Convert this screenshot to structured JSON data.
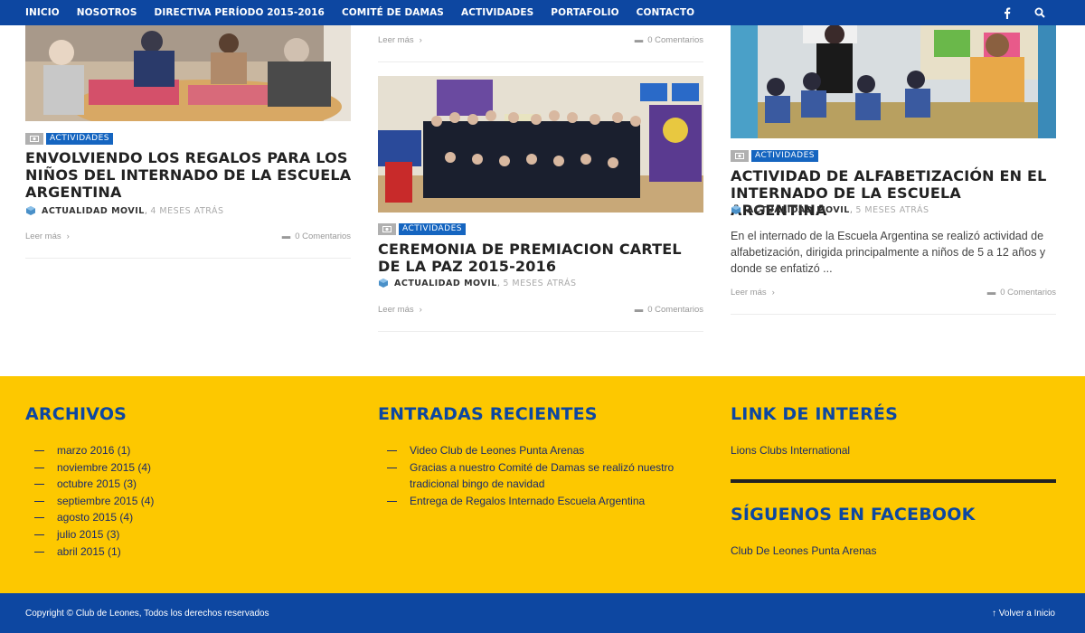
{
  "nav": {
    "items": [
      "INICIO",
      "NOSOTROS",
      "DIRECTIVA PERÍODO 2015-2016",
      "COMITÉ DE DAMAS",
      "ACTIVIDADES",
      "PORTAFOLIO",
      "CONTACTO"
    ],
    "icons": [
      "facebook-icon",
      "search-icon"
    ]
  },
  "posts": [
    {
      "category": "ACTIVIDADES",
      "title": "ENVOLVIENDO LOS REGALOS PARA LOS NIÑOS DEL INTERNADO DE LA ESCUELA ARGENTINA",
      "author": "ACTUALIDAD MOVIL",
      "ago": "4 MESES ATRÁS",
      "read_more": "Leer más",
      "comments": "0 Comentarios"
    },
    {
      "category": "ACTIVIDADES",
      "title": "CEREMONIA DE PREMIACION CARTEL DE LA PAZ 2015-2016",
      "author": "ACTUALIDAD MOVIL",
      "ago": "5 MESES ATRÁS",
      "read_more": "Leer más",
      "comments": "0 Comentarios",
      "prev_read_more": "Leer más",
      "prev_comments": "0 Comentarios"
    },
    {
      "category": "ACTIVIDADES",
      "title": "ACTIVIDAD DE ALFABETIZACIÓN EN EL INTERNADO DE LA ESCUELA ARGENTINA",
      "author": "ACTUALIDAD MOVIL",
      "ago": "5 MESES ATRÁS",
      "excerpt": "En el internado de la Escuela Argentina se realizó actividad de alfabetización, dirigida principalmente a niños de 5 a 12 años y donde se enfatizó ...",
      "read_more": "Leer más",
      "comments": "0 Comentarios"
    }
  ],
  "footer": {
    "archivos": {
      "title": "ARCHIVOS",
      "items": [
        "marzo 2016 (1)",
        "noviembre 2015 (4)",
        "octubre 2015 (3)",
        "septiembre 2015 (4)",
        "agosto 2015 (4)",
        "julio 2015 (3)",
        "abril 2015 (1)"
      ]
    },
    "entradas": {
      "title": "ENTRADAS RECIENTES",
      "items": [
        "Video Club de Leones Punta Arenas",
        "Gracias a nuestro Comité de Damas se realizó nuestro tradicional bingo de navidad",
        "Entrega de Regalos Internado Escuela Argentina"
      ]
    },
    "links": {
      "title": "LINK DE INTERÉS",
      "item": "Lions Clubs International"
    },
    "facebook": {
      "title": "SÍGUENOS EN FACEBOOK",
      "item": "Club De Leones Punta Arenas"
    }
  },
  "bottom": {
    "copyright": "Copyright © Club de Leones, Todos los derechos reservados",
    "back_to_top": "↑ Volver a Inicio"
  },
  "colors": {
    "nav_bg": "#0d47a1",
    "footer_bg": "#fdc800",
    "accent": "#1565c0"
  }
}
